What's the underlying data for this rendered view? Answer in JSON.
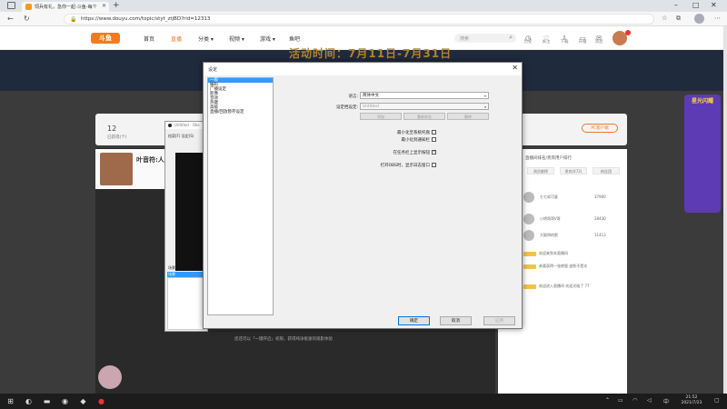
{
  "browser": {
    "tab_title": "饲兵有礼，急你一起-斗鱼-每个",
    "url": "https://www.douyu.com/topic/styt_ztjBD?rid=12313"
  },
  "site": {
    "logo": "斗鱼",
    "nav": [
      "首页",
      "直播",
      "分类 ▾",
      "视频 ▾",
      "游戏 ▾",
      "鱼吧"
    ],
    "search_placeholder": "搜索",
    "header_icons": [
      "历史",
      "关注",
      "下载",
      "开播",
      "消息"
    ],
    "banner_text": "活动时间：7月11日-7月31日",
    "follow_count": "12",
    "follow_label": "已获得(个)",
    "pc_button": "PC客户端",
    "streamer_name": "叶音符:人",
    "bottom_hint": "您还可以「一键开启」权限，获得纯净极速的观影体验",
    "side_title": "直播间排名/贵宾用户排行",
    "side_tabs": [
      "周贡献榜",
      "贵宾(472)",
      "粉丝团"
    ],
    "rank_rows": [
      {
        "name": "七七欢可爱",
        "val": "37900"
      },
      {
        "name": "小明哥哥V哥",
        "val": "28430"
      },
      {
        "name": "大聪明的肥",
        "val": "11413"
      }
    ],
    "chat_rows": [
      "欢迎来到本直播间",
      "恭喜获得一张绝版 皮肤不是光",
      "欢迎进入直播间 欢迎光临了 77"
    ],
    "right_ad": "星光闪耀"
  },
  "obs": {
    "title": "Untitled - Obs",
    "menu": "档案(F)  设定(S)",
    "scenes_label": "场景",
    "scene_selected": "场景"
  },
  "dialog": {
    "title": "设定",
    "categories": [
      "一般",
      "编码",
      "广播设定",
      "影像",
      "音效",
      "热键",
      "高级",
      "直播/回放暂存设定"
    ],
    "selected_category": "一般",
    "language_label": "语言:",
    "language_value": "简体中文",
    "profile_label": "设定档设定:",
    "profile_value": "Untitled",
    "profile_buttons": [
      "添加",
      "重新命名",
      "删除"
    ],
    "checks": [
      {
        "label": "最小化至系统托盘",
        "checked": false
      },
      {
        "label": "最小化到通知栏",
        "checked": false
      },
      {
        "label": "在任务栏上显示按钮",
        "checked": true
      },
      {
        "label": "打开OBS时，显示日志窗口",
        "checked": false
      }
    ],
    "ok": "确定",
    "cancel": "取消",
    "apply": "应用"
  },
  "taskbar": {
    "time": "21:52",
    "date": "2021/7/23"
  }
}
